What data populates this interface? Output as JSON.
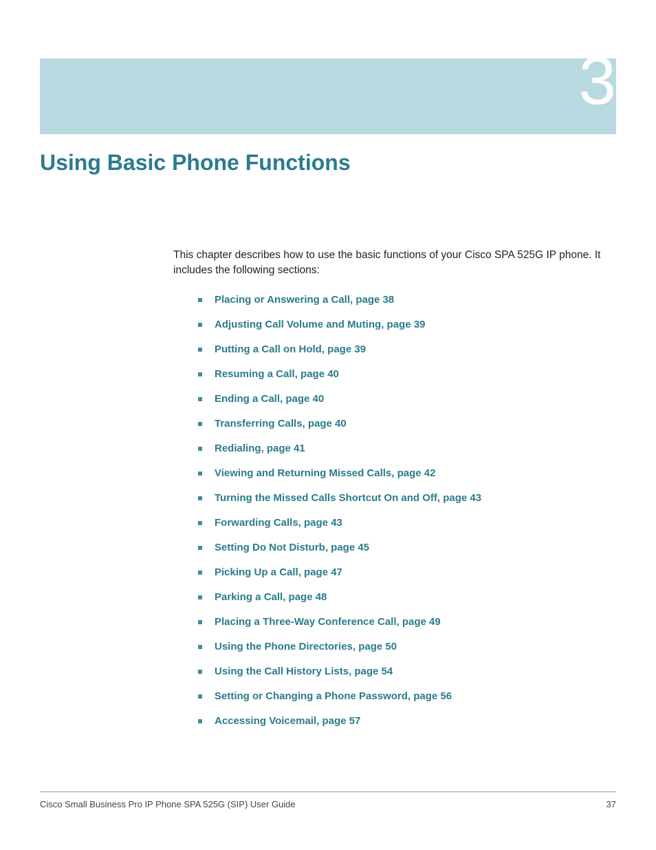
{
  "chapter": {
    "number": "3",
    "title": "Using Basic Phone Functions"
  },
  "intro": "This chapter describes how to use the basic functions of your Cisco SPA 525G IP phone. It includes the following sections:",
  "toc": [
    "Placing or Answering a Call, page 38",
    "Adjusting Call Volume and Muting, page 39",
    "Putting a Call on Hold, page 39",
    "Resuming a Call, page 40",
    "Ending a Call, page 40",
    "Transferring Calls, page 40",
    "Redialing, page 41",
    "Viewing and Returning Missed Calls, page 42",
    "Turning the Missed Calls Shortcut On and Off, page 43",
    "Forwarding Calls, page 43",
    "Setting Do Not Disturb, page 45",
    "Picking Up a Call, page 47",
    "Parking a Call, page 48",
    "Placing a Three-Way Conference Call, page 49",
    "Using the Phone Directories, page 50",
    "Using the Call History Lists, page 54",
    "Setting or Changing a Phone Password, page 56",
    "Accessing Voicemail, page 57"
  ],
  "footer": {
    "guide": "Cisco Small Business Pro IP Phone SPA 525G (SIP) User Guide",
    "page": "37"
  }
}
